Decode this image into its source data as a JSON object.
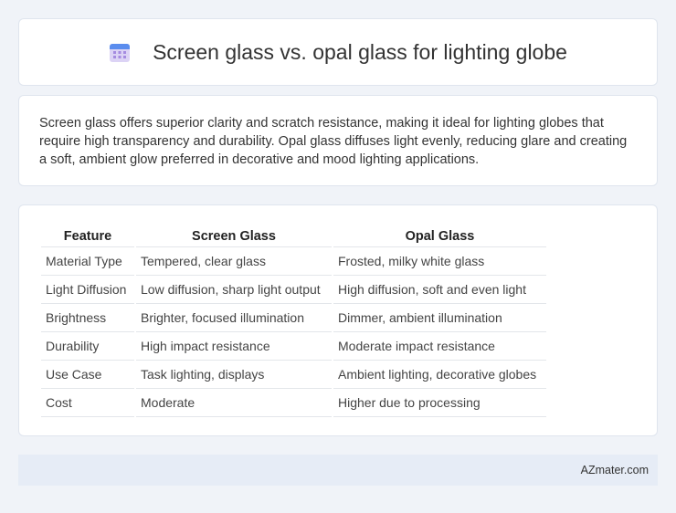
{
  "header": {
    "title": "Screen glass vs. opal glass for lighting globe",
    "icon": "calendar-icon"
  },
  "intro": {
    "text": "Screen glass offers superior clarity and scratch resistance, making it ideal for lighting globes that require high transparency and durability. Opal glass diffuses light evenly, reducing glare and creating a soft, ambient glow preferred in decorative and mood lighting applications."
  },
  "table": {
    "headers": [
      "Feature",
      "Screen Glass",
      "Opal Glass"
    ],
    "rows": [
      [
        "Material Type",
        "Tempered, clear glass",
        "Frosted, milky white glass"
      ],
      [
        "Light Diffusion",
        "Low diffusion, sharp light output",
        "High diffusion, soft and even light"
      ],
      [
        "Brightness",
        "Brighter, focused illumination",
        "Dimmer, ambient illumination"
      ],
      [
        "Durability",
        "High impact resistance",
        "Moderate impact resistance"
      ],
      [
        "Use Case",
        "Task lighting, displays",
        "Ambient lighting, decorative globes"
      ],
      [
        "Cost",
        "Moderate",
        "Higher due to processing"
      ]
    ]
  },
  "footer": {
    "site": "AZmater.com"
  },
  "colors": {
    "background": "#f0f3f8",
    "footer_bg": "#e6ecf6",
    "icon_top": "#5b8dee",
    "icon_body": "#dcd3f5"
  }
}
